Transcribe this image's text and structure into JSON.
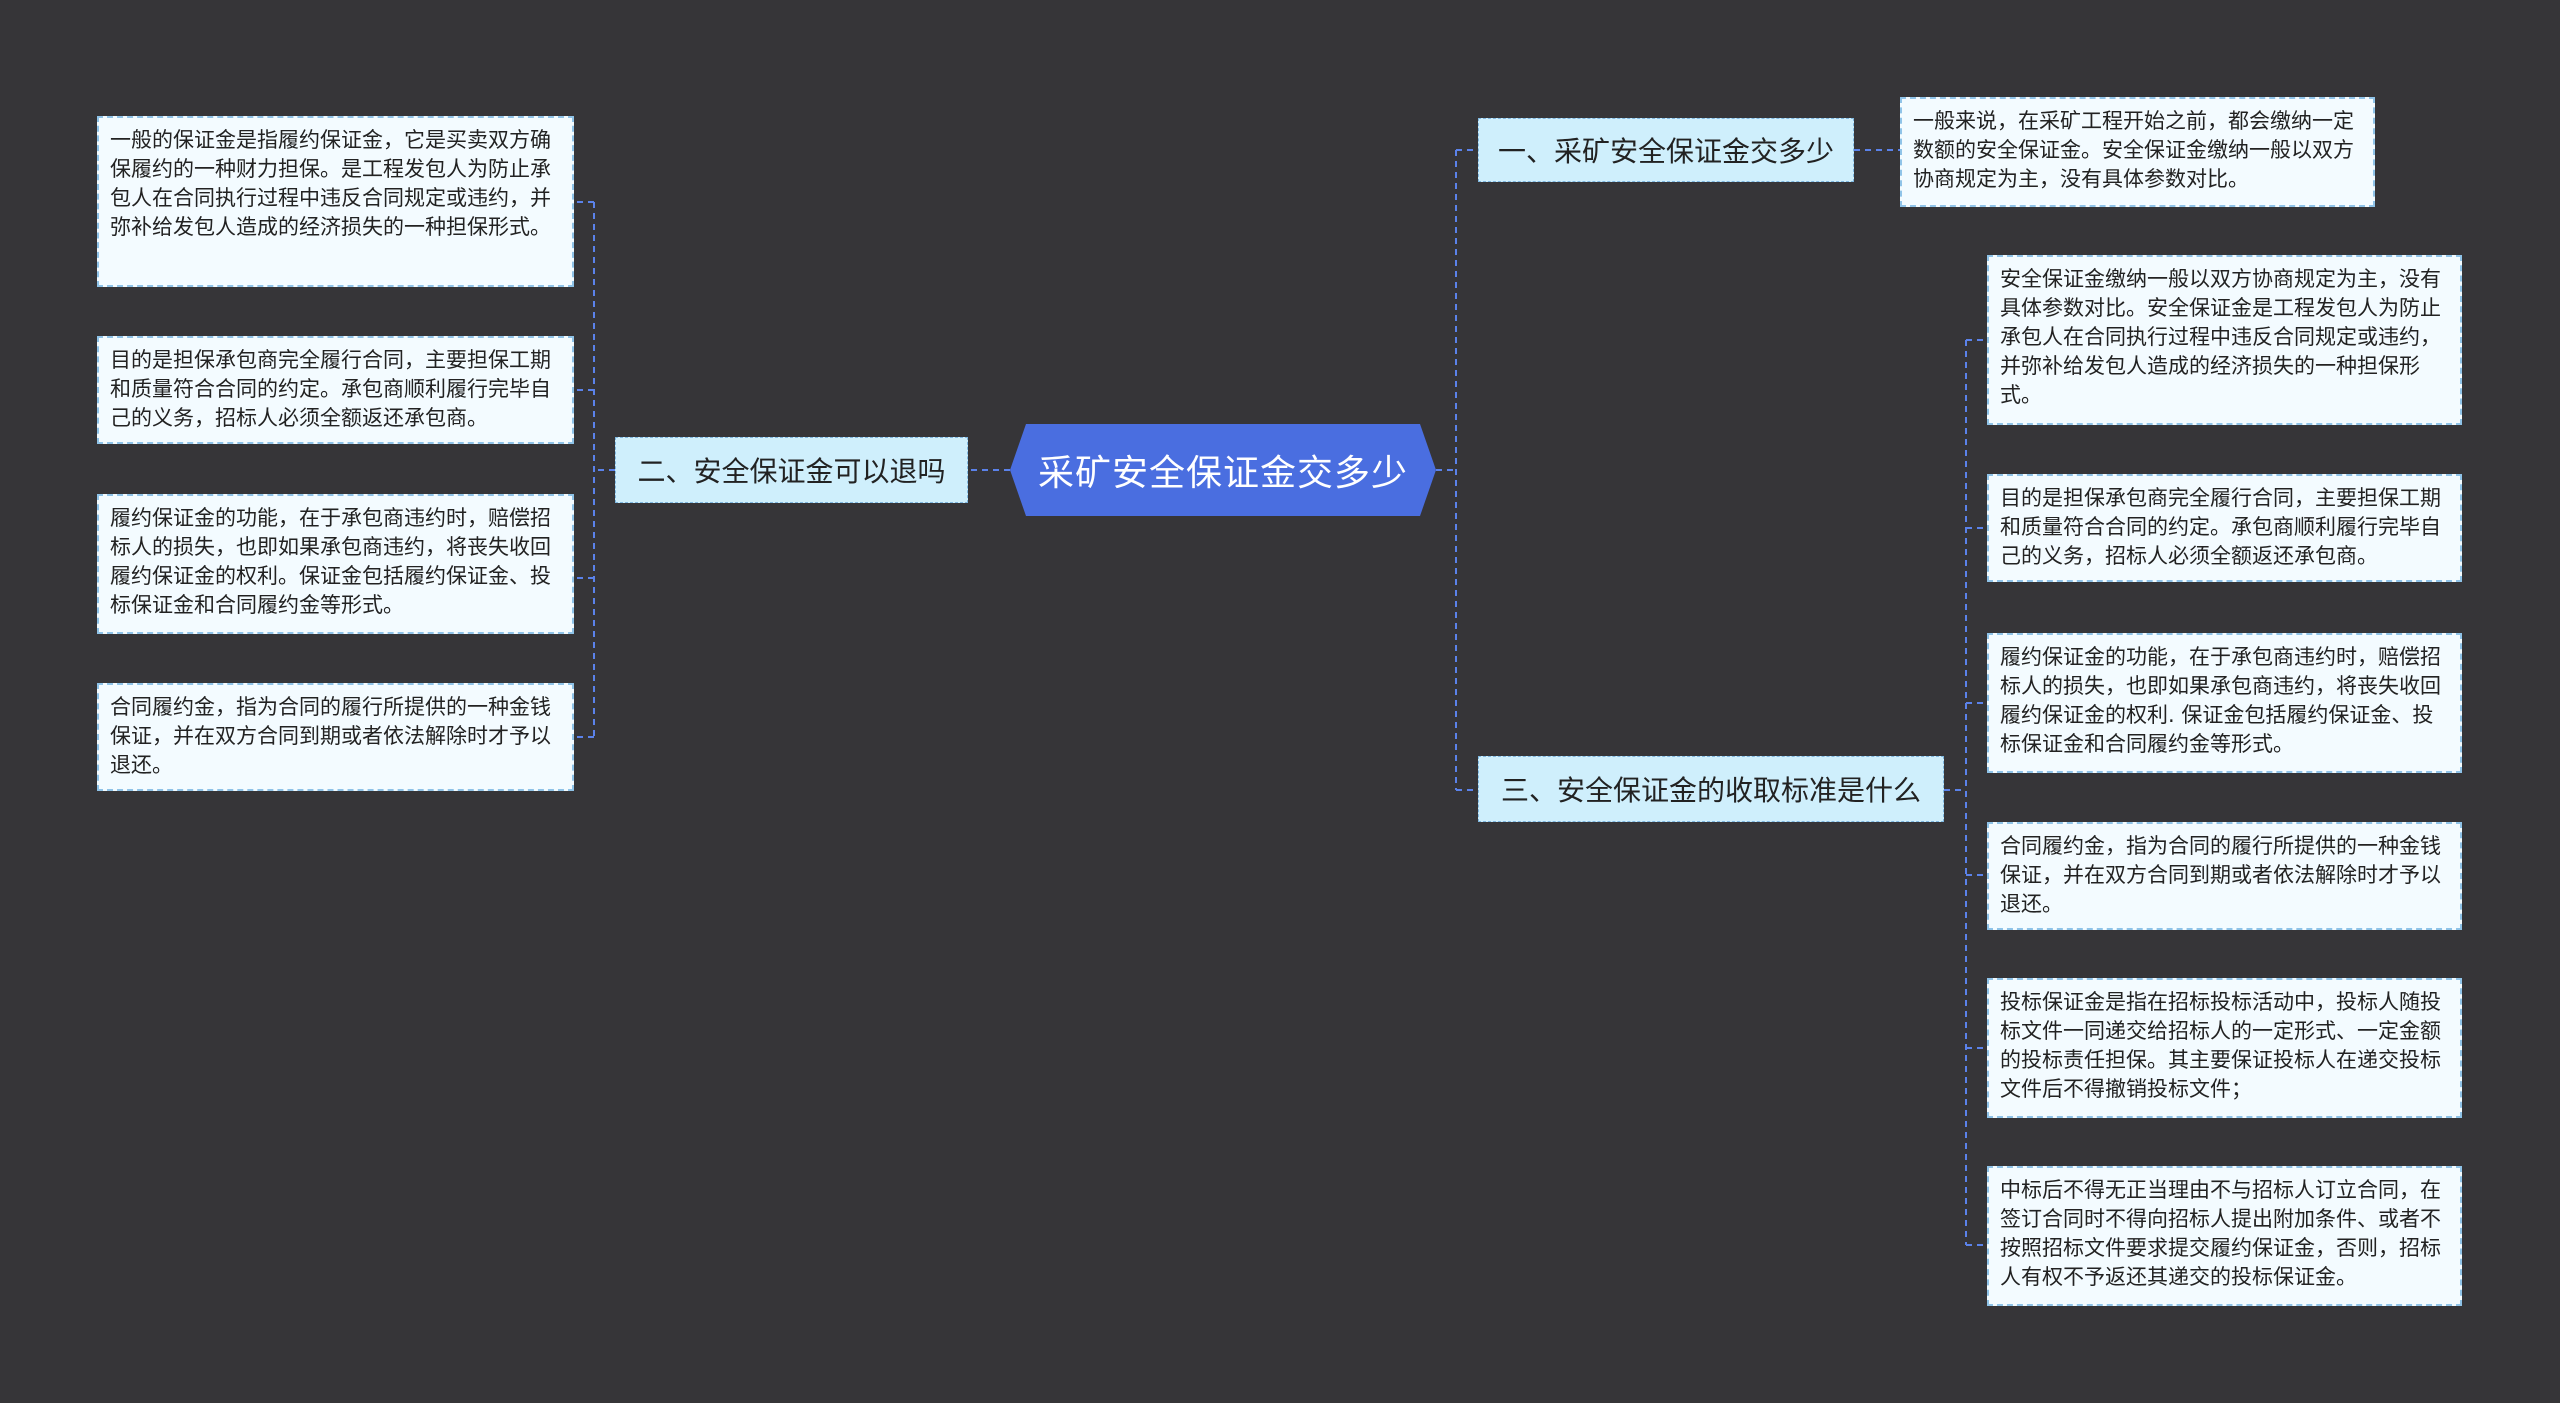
{
  "root": {
    "label": "采矿安全保证金交多少"
  },
  "colors": {
    "background": "#363538",
    "root_fill": "#4a6ee0",
    "branch_fill": "#cfeffc",
    "leaf_fill": "#f3fbff",
    "connector": "#5b82ea"
  },
  "branches": {
    "b1": {
      "label": "一、采矿安全保证金交多少",
      "leaves": [
        "一般来说，在采矿工程开始之前，都会缴纳一定数额的安全保证金。安全保证金缴纳一般以双方协商规定为主，没有具体参数对比。"
      ]
    },
    "b2": {
      "label": "二、安全保证金可以退吗",
      "leaves": [
        "一般的保证金是指履约保证金，它是买卖双方确保履约的一种财力担保。是工程发包人为防止承包人在合同执行过程中违反合同规定或违约，并弥补给发包人造成的经济损失的一种担保形式。",
        "目的是担保承包商完全履行合同，主要担保工期和质量符合合同的约定。承包商顺利履行完毕自己的义务，招标人必须全额返还承包商。",
        "履约保证金的功能，在于承包商违约时，赔偿招标人的损失，也即如果承包商违约，将丧失收回履约保证金的权利。保证金包括履约保证金、投标保证金和合同履约金等形式。",
        "合同履约金，指为合同的履行所提供的一种金钱保证，并在双方合同到期或者依法解除时才予以退还。"
      ]
    },
    "b3": {
      "label": "三、安全保证金的收取标准是什么",
      "leaves": [
        "安全保证金缴纳一般以双方协商规定为主，没有具体参数对比。安全保证金是工程发包人为防止承包人在合同执行过程中违反合同规定或违约，并弥补给发包人造成的经济损失的一种担保形式。",
        "目的是担保承包商完全履行合同，主要担保工期和质量符合合同的约定。承包商顺利履行完毕自己的义务，招标人必须全额返还承包商。",
        "履约保证金的功能，在于承包商违约时，赔偿招标人的损失，也即如果承包商违约，将丧失收回履约保证金的权利. 保证金包括履约保证金、投标保证金和合同履约金等形式。",
        "合同履约金，指为合同的履行所提供的一种金钱保证，并在双方合同到期或者依法解除时才予以退还。",
        "投标保证金是指在招标投标活动中，投标人随投标文件一同递交给招标人的一定形式、一定金额的投标责任担保。其主要保证投标人在递交投标文件后不得撤销投标文件；",
        "中标后不得无正当理由不与招标人订立合同，在签订合同时不得向招标人提出附加条件、或者不按照招标文件要求提交履约保证金，否则，招标人有权不予返还其递交的投标保证金。"
      ]
    }
  }
}
